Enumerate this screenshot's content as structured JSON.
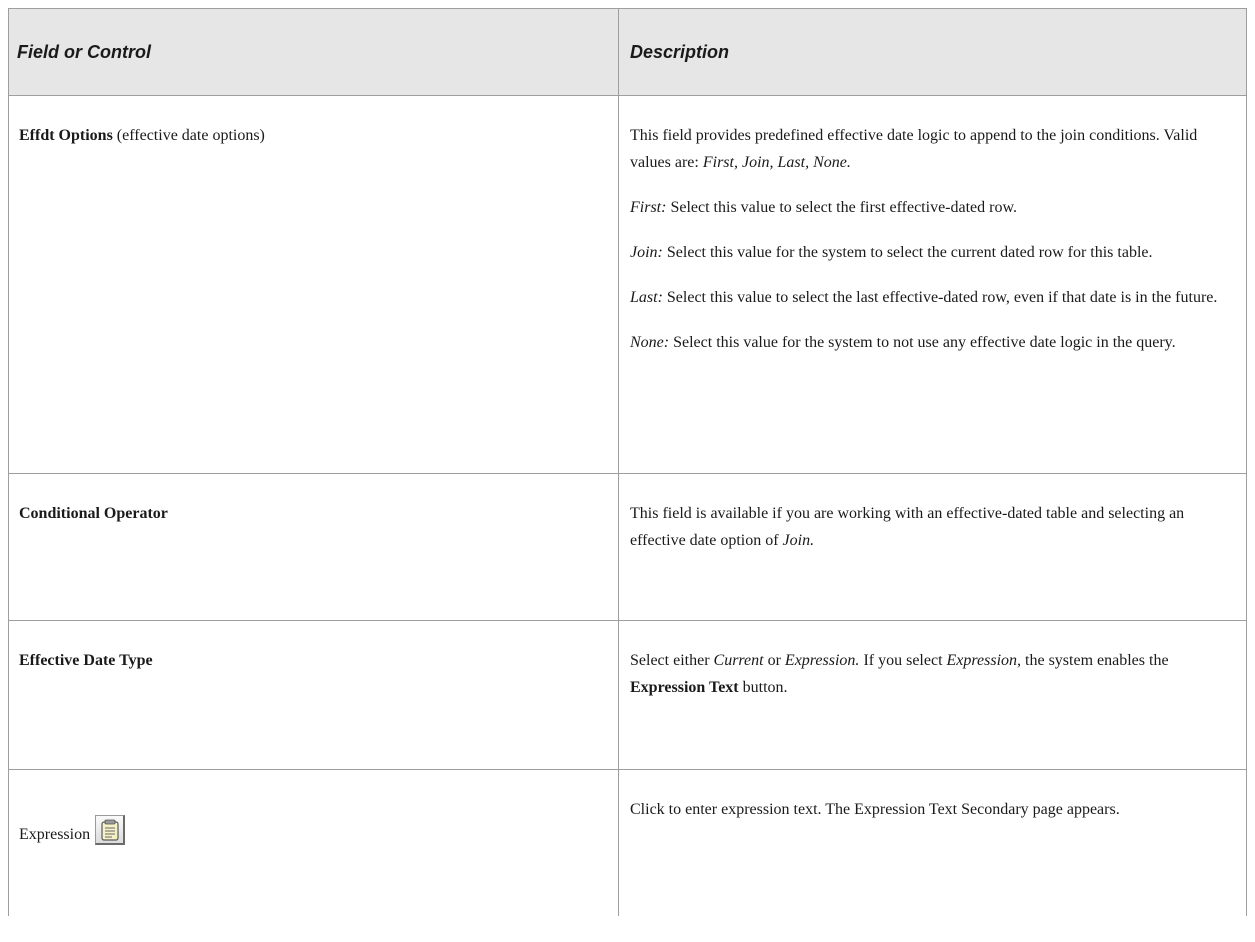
{
  "header": {
    "col1": "Field or Control",
    "col2": "Description"
  },
  "rows": [
    {
      "field": "Effdt Options",
      "field_suffix": " (effective date options)",
      "desc": [
        {
          "text": "This field provides predefined effective date logic to append to the join conditions. Valid values are: ",
          "em": "First, Join, Last, None."
        },
        {
          "em": "First:",
          "text": " Select this value to select the first effective-dated row."
        },
        {
          "em": "Join:",
          "text": " Select this value for the system to select the current dated row for this table."
        },
        {
          "em": "Last:",
          "text": " Select this value to select the last effective-dated row, even if that date is in the future."
        },
        {
          "em": "None:",
          "text": " Select this value for the system to not use any effective date logic in the query."
        }
      ]
    },
    {
      "field": "Conditional Operator",
      "desc_text": "This field is available if you are working with an effective-dated table and selecting an effective date option of ",
      "desc_em": "Join."
    },
    {
      "field": "Effective Date Type",
      "desc_a": "Select either ",
      "desc_em1": "Current",
      "desc_b": " or ",
      "desc_em2": "Expression.",
      "desc_c": " If you select ",
      "desc_em3": "Expression,",
      "desc_d": " the system enables the ",
      "desc_strong": "Expression Text",
      "desc_e": " button."
    },
    {
      "field": "Expression",
      "icon": "notepad-icon",
      "desc_text": "Click to enter expression text. The Expression Text Secondary page appears."
    }
  ]
}
